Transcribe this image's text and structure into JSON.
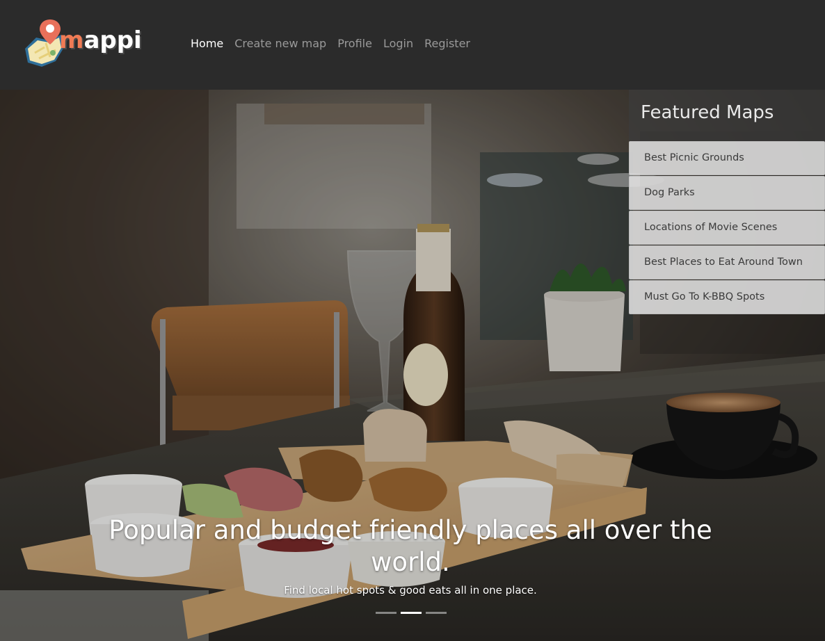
{
  "brand": {
    "name_first": "m",
    "name_rest": "appi",
    "icon": "map-pin-logo-icon",
    "accent_color": "#f07b55"
  },
  "nav": {
    "items": [
      {
        "label": "Home",
        "active": true
      },
      {
        "label": "Create new map",
        "active": false
      },
      {
        "label": "Profile",
        "active": false
      },
      {
        "label": "Login",
        "active": false
      },
      {
        "label": "Register",
        "active": false
      }
    ]
  },
  "featured": {
    "title": "Featured Maps",
    "items": [
      {
        "label": "Best Picnic Grounds"
      },
      {
        "label": "Dog Parks"
      },
      {
        "label": "Locations of Movie Scenes"
      },
      {
        "label": "Best Places to Eat Around Town"
      },
      {
        "label": "Must Go To K-BBQ Spots"
      }
    ]
  },
  "carousel": {
    "heading": "Popular and budget friendly places all over the world.",
    "subheading": "Find local hot spots & good eats all in one place.",
    "slide_count": 3,
    "active_slide": 2
  }
}
